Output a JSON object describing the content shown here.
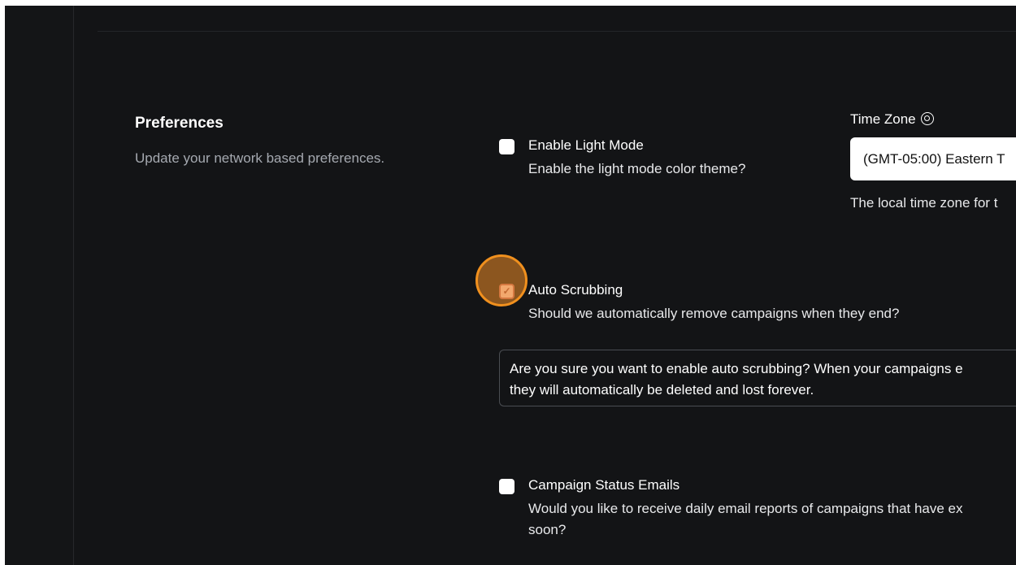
{
  "preferences": {
    "title": "Preferences",
    "description": "Update your network based preferences."
  },
  "options": {
    "light_mode": {
      "label": "Enable Light Mode",
      "description": "Enable the light mode color theme?",
      "checked": false
    },
    "auto_scrubbing": {
      "label": "Auto Scrubbing",
      "description": "Should we automatically remove campaigns when they end?",
      "checked": true,
      "warning_line1": "Are you sure you want to enable auto scrubbing? When your campaigns e",
      "warning_line2": "they will automatically be deleted and lost forever."
    },
    "status_emails": {
      "label": "Campaign Status Emails",
      "description_line1": "Would you like to receive daily email reports of campaigns that have ex",
      "description_line2": "soon?",
      "checked": false
    }
  },
  "timezone": {
    "label": "Time Zone",
    "icon": "globe-icon",
    "value": "(GMT-05:00) Eastern T",
    "help": "The local time zone for t"
  },
  "icons": {
    "checkmark": "✓"
  },
  "colors": {
    "background": "#131416",
    "cursor_highlight": "#f0901e",
    "checked_box": "#f3c9c1"
  }
}
